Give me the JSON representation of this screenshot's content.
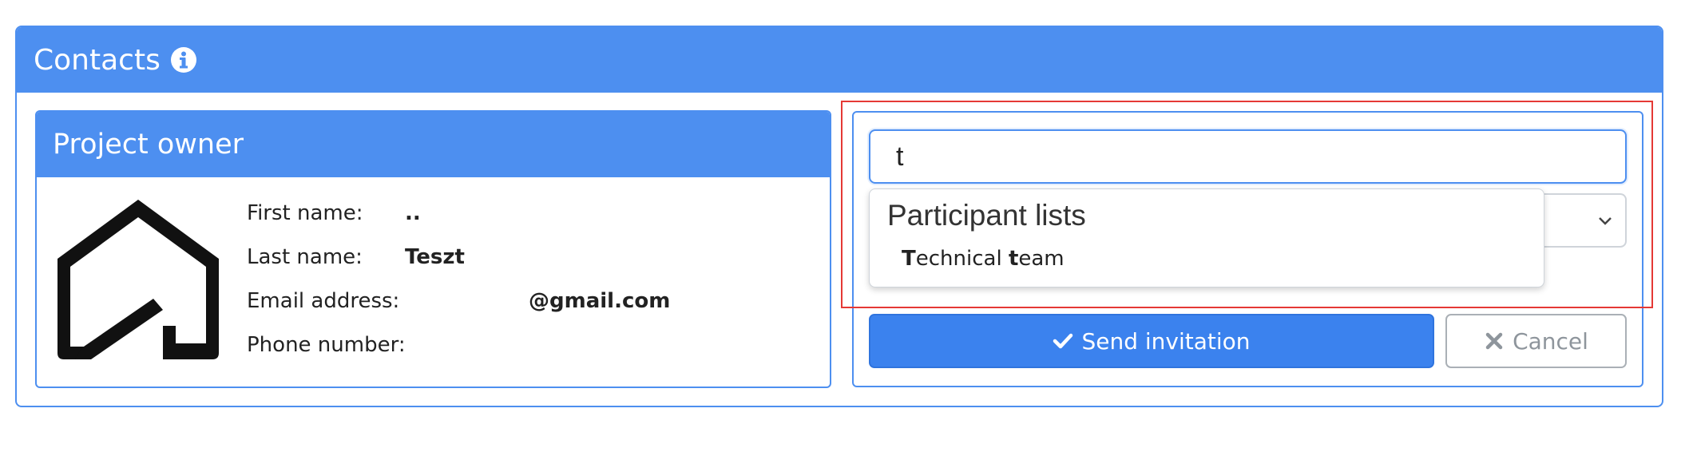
{
  "contacts_panel": {
    "title": "Contacts",
    "info_icon": "info-circle-icon"
  },
  "owner_card": {
    "title": "Project owner",
    "logo_icon": "house-outline-icon",
    "fields": [
      {
        "label": "First name:",
        "value": ".."
      },
      {
        "label": "Last name:",
        "value": "Teszt"
      },
      {
        "label": "Email address:",
        "value": "@gmail.com"
      },
      {
        "label": "Phone number:",
        "value": ""
      }
    ]
  },
  "invite_form": {
    "search_value": "t",
    "select_value": "",
    "autocomplete": {
      "group_heading": "Participant lists",
      "options": [
        {
          "label": "Technical team",
          "match": "t"
        }
      ]
    },
    "send_label": "Send invitation",
    "send_icon": "check-icon",
    "cancel_label": "Cancel",
    "cancel_icon": "close-icon"
  },
  "colors": {
    "accent": "#4d8ff0",
    "primary_button": "#3b82ee",
    "highlight": "#e53935"
  }
}
